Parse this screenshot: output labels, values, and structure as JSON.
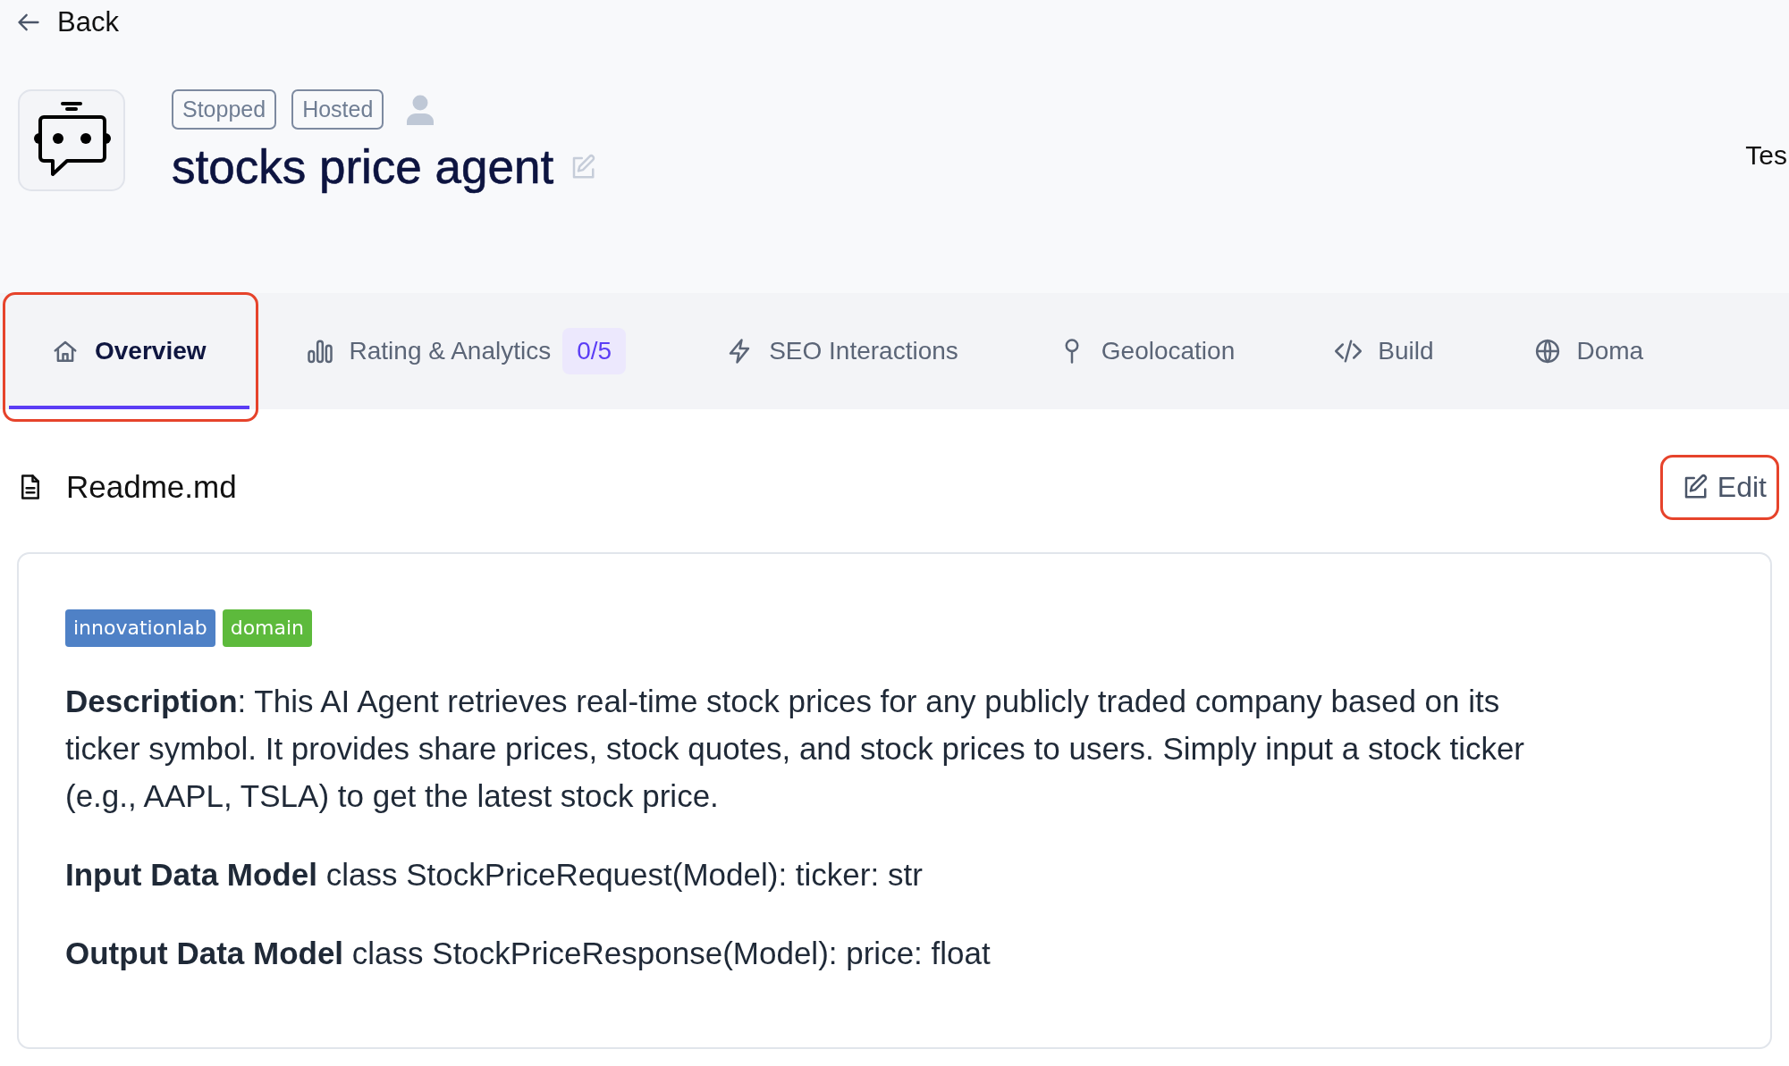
{
  "back_link": {
    "label": "Back"
  },
  "agent": {
    "status_badges": [
      "Stopped",
      "Hosted"
    ],
    "name": "stocks price agent"
  },
  "header_right_text": "Tes",
  "tabs": [
    {
      "label": "Overview",
      "selected": true,
      "highlighted": true
    },
    {
      "label": "Rating & Analytics",
      "badge": "0/5",
      "selected": false,
      "highlighted": false
    },
    {
      "label": "SEO Interactions",
      "selected": false,
      "highlighted": false
    },
    {
      "label": "Geolocation",
      "selected": false,
      "highlighted": false
    },
    {
      "label": "Build",
      "selected": false,
      "highlighted": false
    },
    {
      "label": "Doma",
      "selected": false,
      "highlighted": false
    }
  ],
  "readme": {
    "file_name": "Readme.md",
    "edit_button": {
      "label": "Edit",
      "highlighted": true
    },
    "tags": [
      {
        "label": "innovationlab",
        "color": "#4f81c6"
      },
      {
        "label": "domain",
        "color": "#5dba3c"
      }
    ],
    "paragraphs": [
      "**Description**: This AI Agent retrieves real-time stock prices for any publicly traded company based on its ticker symbol. It provides share prices, stock quotes, and stock prices to users. Simply input a stock ticker (e.g., AAPL, TSLA) to get the latest stock price.",
      "**Input Data Model** class StockPriceRequest(Model): ticker: str",
      "**Output Data Model** class StockPriceResponse(Model): price: float"
    ]
  }
}
